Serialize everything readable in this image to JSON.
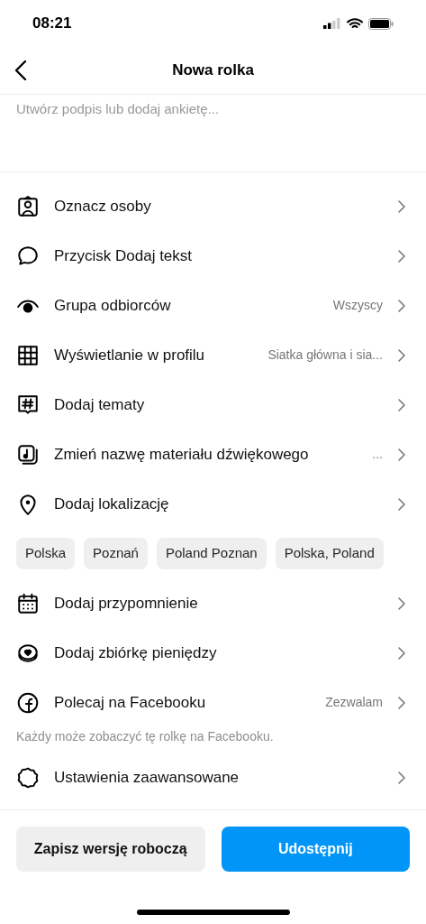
{
  "status_bar": {
    "time": "08:21"
  },
  "header": {
    "title": "Nowa rolka"
  },
  "caption": {
    "placeholder": "Utwórz podpis lub dodaj ankietę..."
  },
  "rows": [
    {
      "kind": "row",
      "label": "Oznacz osoby"
    },
    {
      "kind": "row",
      "label": "Przycisk Dodaj tekst"
    },
    {
      "kind": "row",
      "label": "Grupa odbiorców",
      "value": "Wszyscy"
    },
    {
      "kind": "row",
      "label": "Wyświetlanie w profilu",
      "value": "Siatka główna i sia..."
    },
    {
      "kind": "row",
      "label": "Dodaj tematy"
    },
    {
      "kind": "row",
      "label": "Zmień nazwę materiału dźwiękowego",
      "value": "..."
    },
    {
      "kind": "row",
      "label": "Dodaj lokalizację"
    },
    {
      "kind": "chips",
      "chips": [
        "Polska",
        "Poznań",
        "Poland Poznan",
        "Polska, Poland"
      ]
    },
    {
      "kind": "row",
      "label": "Dodaj przypomnienie"
    },
    {
      "kind": "row",
      "label": "Dodaj zbiórkę pieniędzy"
    },
    {
      "kind": "row",
      "label": "Polecaj na Facebooku",
      "value": "Zezwalam"
    },
    {
      "kind": "note",
      "text": "Każdy może zobaczyć tę rolkę na Facebooku."
    },
    {
      "kind": "row",
      "label": "Ustawienia zaawansowane"
    }
  ],
  "buttons": {
    "draft": "Zapisz wersję roboczą",
    "share": "Udostępnij"
  }
}
